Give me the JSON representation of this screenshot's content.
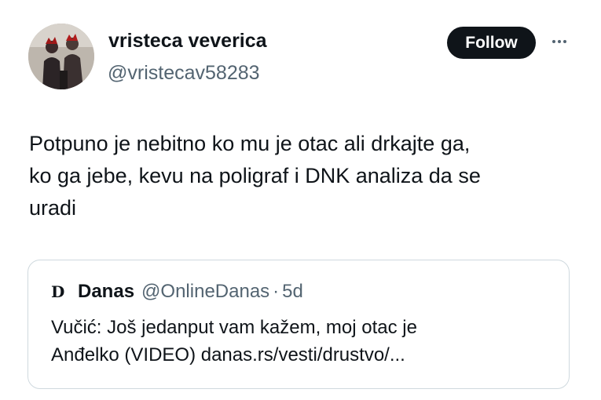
{
  "tweet": {
    "author": {
      "display_name": "vristeca veverica",
      "handle": "@vristecav58283",
      "avatar_icon": "profile-photo"
    },
    "follow_label": "Follow",
    "more_icon": "more-dots-icon",
    "text": "Potpuno je nebitno ko mu je otac ali drkajte ga,\nko ga jebe, kevu na poligraf i DNK analiza da se\nuradi"
  },
  "quote": {
    "logo_letter": "D",
    "name": "Danas",
    "handle": "@OnlineDanas",
    "separator": "·",
    "time": "5d",
    "text": "Vučić: Još jedanput vam kažem, moj otac je\nAnđelko (VIDEO) danas.rs/vesti/drustvo/..."
  },
  "colors": {
    "text_primary": "#0f1419",
    "text_secondary": "#536471",
    "border": "#cfd9de",
    "button_bg": "#0f1419"
  }
}
